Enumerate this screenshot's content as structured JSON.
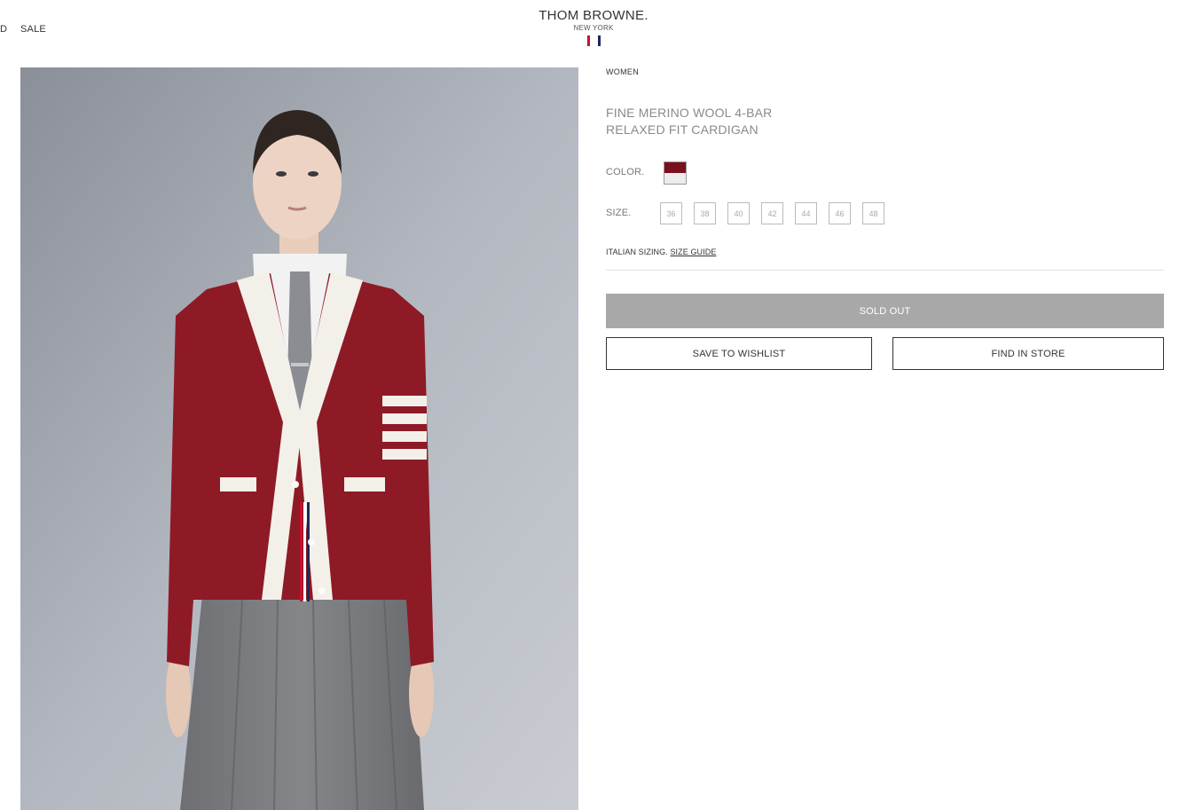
{
  "header": {
    "nav_items": [
      "D",
      "SALE"
    ],
    "brand_name": "THOM BROWNE.",
    "brand_city": "NEW YORK",
    "flag_colors": [
      "#c8102e",
      "#ffffff",
      "#1b2a5c"
    ]
  },
  "product": {
    "breadcrumb": "WOMEN",
    "title_line1": "FINE MERINO WOOL 4-BAR",
    "title_line2": "RELAXED FIT CARDIGAN",
    "color_label": "COLOR.",
    "swatch_color": "#7a0f1d",
    "size_label": "SIZE.",
    "sizes": [
      "36",
      "38",
      "40",
      "42",
      "44",
      "46",
      "48"
    ],
    "sizing_note": "ITALIAN SIZING.",
    "size_guide": "SIZE GUIDE",
    "sold_out": "SOLD OUT",
    "wishlist": "SAVE TO WISHLIST",
    "find_store": "FIND IN STORE"
  }
}
